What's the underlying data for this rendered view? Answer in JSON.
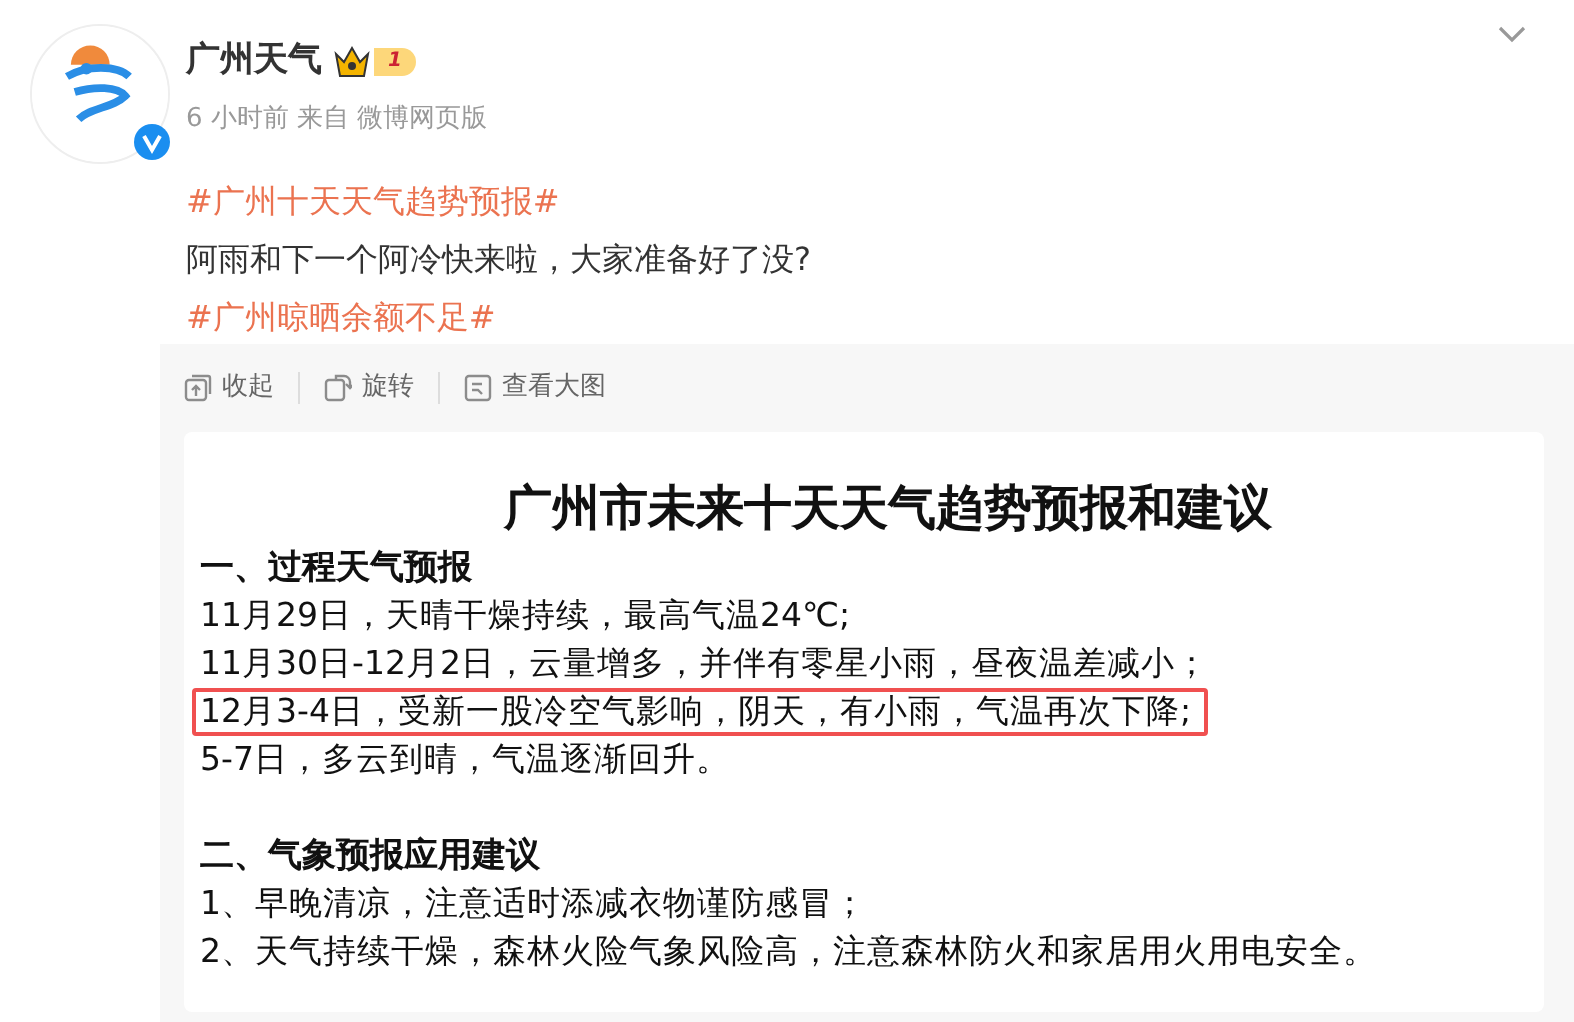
{
  "post": {
    "author": "广州天气",
    "level_badge": "1",
    "verified": true,
    "meta": "6 小时前  来自 微博网页版",
    "content": [
      {
        "kind": "topic",
        "text": "#广州十天天气趋势预报#"
      },
      {
        "kind": "text",
        "text": "阿雨和下一个阿冷快来啦，大家准备好了没?"
      },
      {
        "kind": "topic",
        "text": "#广州晾晒余额不足#"
      }
    ]
  },
  "toolbar": [
    {
      "kind": "collapse",
      "label": "收起"
    },
    {
      "kind": "rotate",
      "label": "旋转"
    },
    {
      "kind": "view",
      "label": "查看大图"
    }
  ],
  "image": {
    "title": "广州市未来十天天气趋势预报和建议",
    "sections": [
      {
        "heading": "一、过程天气预报",
        "lines": [
          {
            "text": "11月29日，天晴干燥持续，最高气温24℃;",
            "highlighted": false
          },
          {
            "text": "11月30日-12月2日，云量增多，并伴有零星小雨，昼夜温差减小；",
            "highlighted": false
          },
          {
            "text": "12月3-4日，受新一股冷空气影响，阴天，有小雨，气温再次下降;",
            "highlighted": true
          },
          {
            "text": "5-7日，多云到晴，气温逐渐回升。",
            "highlighted": false
          }
        ]
      },
      {
        "heading": "二、气象预报应用建议",
        "lines": [
          {
            "text": "1、早晚清凉，注意适时添减衣物谨防感冒；",
            "highlighted": false
          },
          {
            "text": "2、天气持续干燥，森林火险气象风险高，注意森林防火和家居用火用电安全。",
            "highlighted": false
          }
        ]
      }
    ]
  }
}
